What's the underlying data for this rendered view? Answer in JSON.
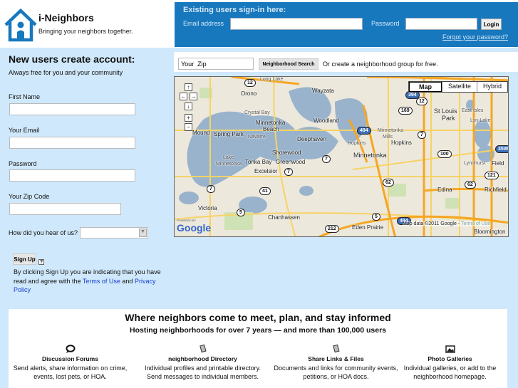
{
  "header": {
    "title": "i-Neighbors",
    "tagline": "Bringing your neighbors together.",
    "brand_color": "#1878be"
  },
  "signin": {
    "heading": "Existing users sign-in here:",
    "email_label": "Email address",
    "email_value": "",
    "password_label": "Password",
    "password_value": "",
    "login_label": "Login",
    "forgot_label": "Forgot your password?"
  },
  "signup": {
    "heading": "New users create account:",
    "subheading": "Always free for you and your community",
    "first_name_label": "First Name",
    "email_label": "Your Email",
    "password_label": "Password",
    "zip_label": "Your Zip Code",
    "hear_label": "How did you hear of us?",
    "hear_value": "",
    "button_label": "Sign Up",
    "help_label": "?",
    "terms_prefix": "By clicking Sign Up you are indicating that you have read and agree with the ",
    "terms_link": "Terms of Use",
    "terms_and": " and ",
    "privacy_link": "Privacy Policy"
  },
  "search": {
    "zip_placeholder": "Your  Zip",
    "button_label": "Neighborhood Search",
    "or_create": "Or create a neighborhood group for free."
  },
  "map": {
    "types": [
      "Map",
      "Satellite",
      "Hybrid"
    ],
    "selected_type": "Map",
    "nav": [
      "↑",
      "←",
      "→",
      "↓",
      "+",
      "−"
    ],
    "labels": [
      "Orono",
      "Wayzata",
      "Crystal Bay",
      "Minnetonka",
      "Beach",
      "Woodland",
      "Mound",
      "Spring Park",
      "Navarre",
      "Deephaven",
      "Shorewood",
      "Lake",
      "Minnetonka",
      "Tonka Bay",
      "Greenwood",
      "Excelsior",
      "Victoria",
      "Chanhassen",
      "St Louis",
      "Park",
      "East Isles",
      "Lyn-Lake",
      "Minnetonka",
      "Mills",
      "Hopkins",
      "Hopkins",
      "Minnetonka",
      "Lynnhurst",
      "Edina",
      "Richfield",
      "Eden Prairie",
      "Bloomington",
      "Long Lake",
      "Field"
    ],
    "shields": [
      "12",
      "7",
      "7",
      "41",
      "7",
      "5",
      "212",
      "394",
      "12",
      "169",
      "494",
      "7",
      "100",
      "62",
      "62",
      "121",
      "5",
      "494",
      "35W"
    ],
    "powered_by": "POWERED BY",
    "google": "Google",
    "attribution": "Map data ©2011 Google - ",
    "terms": "Terms of Use"
  },
  "features": {
    "heading": "Where neighbors come to meet, plan, and stay informed",
    "subheading": "Hosting neighborhoods for over 7 years — and more than 100,000 users",
    "items": [
      {
        "icon": "speech-bubble-icon",
        "title": "Discussion Forums",
        "desc": "Send alerts, share information on crime, events, lost pets, or HOA."
      },
      {
        "icon": "document-icon",
        "title": "neighborhood Directory",
        "desc": "Individual profiles and printable directory. Send messages to individual members."
      },
      {
        "icon": "document-icon",
        "title": "Share Links & Files",
        "desc": "Documents and links for community events, petitions, or HOA docs."
      },
      {
        "icon": "photo-icon",
        "title": "Photo Galleries",
        "desc": "Individual galleries, or add to the neighborhood homepage."
      }
    ]
  }
}
